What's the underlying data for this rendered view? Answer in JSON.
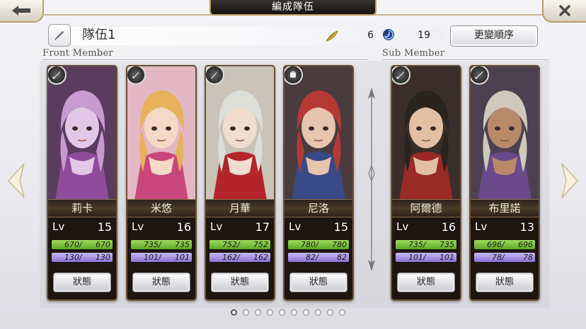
{
  "header": {
    "title": "編成隊伍",
    "team_name": "隊伍1",
    "feather_icon": "feather-icon",
    "feather_count": "6",
    "gem_icon": "swirl-gem-icon",
    "gem_count": "19",
    "reorder_label": "更變順序"
  },
  "sections": {
    "front_label": "Front Member",
    "sub_label": "Sub Member"
  },
  "members": [
    {
      "name": "莉卡",
      "lv_label": "Lv",
      "level": "15",
      "hp": "670",
      "hp_max": "670",
      "mp": "130",
      "mp_max": "130",
      "hp_ratio": 1.0,
      "mp_ratio": 1.0,
      "status_label": "狀態",
      "weapon_icon": "sword-icon",
      "group": "front",
      "palette": {
        "bg": "#5a3c5e",
        "hair": "#c79ad0",
        "skin": "#e3c7e6",
        "accent": "#8e4b9c"
      }
    },
    {
      "name": "米悠",
      "lv_label": "Lv",
      "level": "16",
      "hp": "735",
      "hp_max": "735",
      "mp": "101",
      "mp_max": "101",
      "hp_ratio": 1.0,
      "mp_ratio": 1.0,
      "status_label": "狀態",
      "weapon_icon": "dagger-icon",
      "group": "front",
      "palette": {
        "bg": "#e3b7c3",
        "hair": "#e6b25a",
        "skin": "#f6d8c6",
        "accent": "#c9467a"
      }
    },
    {
      "name": "月華",
      "lv_label": "Lv",
      "level": "17",
      "hp": "752",
      "hp_max": "752",
      "mp": "162",
      "mp_max": "162",
      "hp_ratio": 1.0,
      "mp_ratio": 1.0,
      "status_label": "狀態",
      "weapon_icon": "katana-icon",
      "group": "front",
      "palette": {
        "bg": "#c9c3b8",
        "hair": "#dcded8",
        "skin": "#f1ddd0",
        "accent": "#b3252a"
      }
    },
    {
      "name": "尼洛",
      "lv_label": "Lv",
      "level": "15",
      "hp": "780",
      "hp_max": "780",
      "mp": "82",
      "mp_max": "82",
      "hp_ratio": 1.0,
      "mp_ratio": 1.0,
      "status_label": "狀態",
      "weapon_icon": "fist-icon",
      "group": "front",
      "palette": {
        "bg": "#4a3b3e",
        "hair": "#b53a36",
        "skin": "#e7c4ad",
        "accent": "#3a4a86"
      }
    },
    {
      "name": "阿爾德",
      "lv_label": "Lv",
      "level": "16",
      "hp": "735",
      "hp_max": "735",
      "mp": "101",
      "mp_max": "101",
      "hp_ratio": 1.0,
      "mp_ratio": 1.0,
      "status_label": "狀態",
      "weapon_icon": "sword-icon",
      "group": "sub",
      "palette": {
        "bg": "#3b2e2a",
        "hair": "#2a2320",
        "skin": "#e3bfa3",
        "accent": "#9a2a26"
      }
    },
    {
      "name": "布里諾",
      "lv_label": "Lv",
      "level": "13",
      "hp": "696",
      "hp_max": "696",
      "mp": "78",
      "mp_max": "78",
      "hp_ratio": 1.0,
      "mp_ratio": 1.0,
      "status_label": "狀態",
      "weapon_icon": "sword-icon",
      "group": "sub",
      "palette": {
        "bg": "#4b4150",
        "hair": "#cfc9bd",
        "skin": "#b98a6a",
        "accent": "#6a4a8a"
      }
    }
  ],
  "pagination": {
    "count": 10,
    "active_index": 0
  },
  "colors": {
    "hp_fill": "#7cc443",
    "mp_fill": "#a592e5",
    "frame_gold": "#b59d6a"
  }
}
